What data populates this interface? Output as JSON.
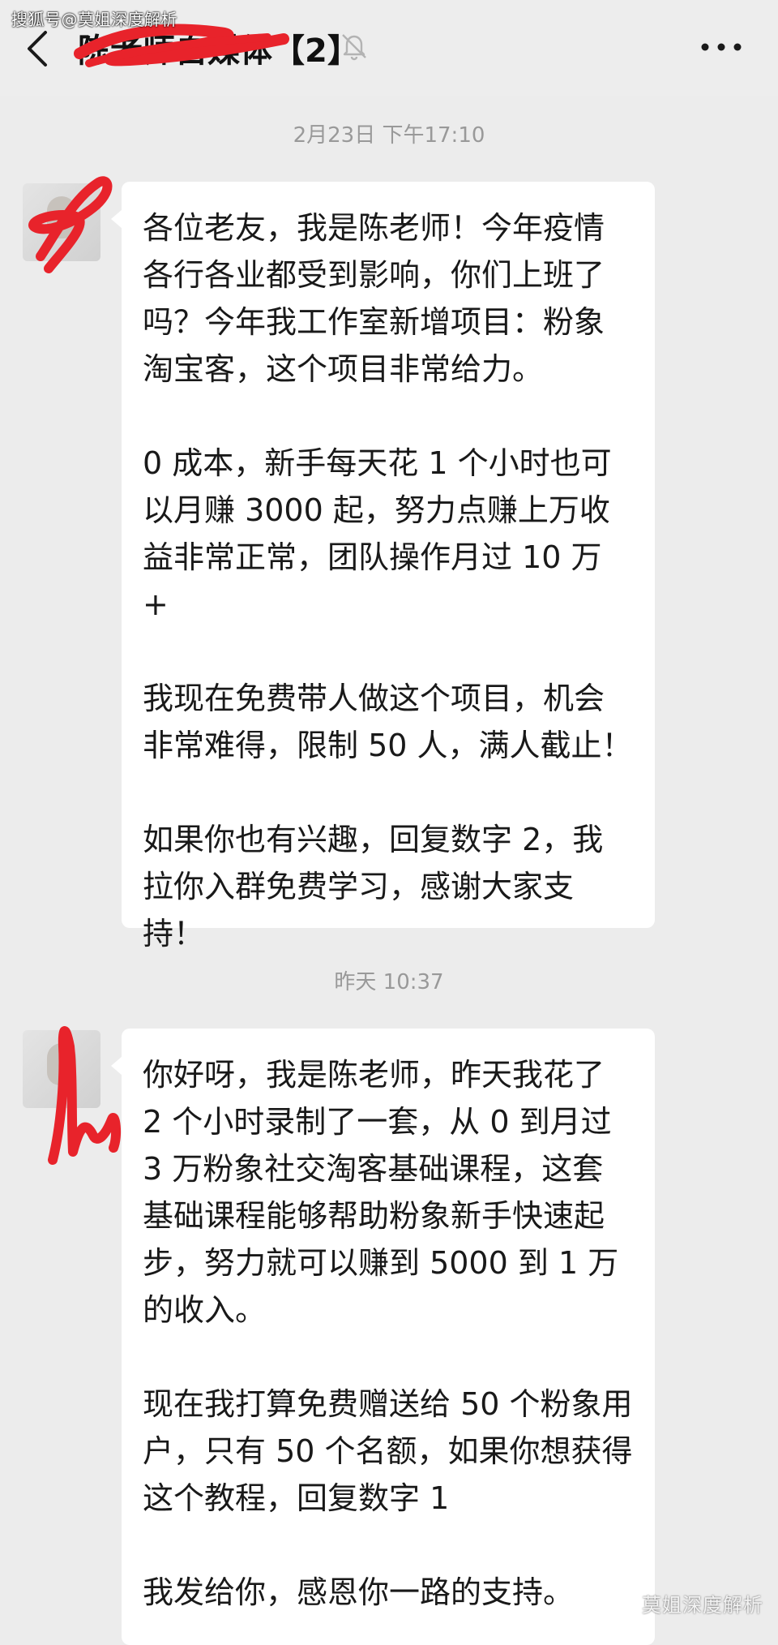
{
  "watermark_top": "搜狐号@莫姐深度解析",
  "header": {
    "title": "陈老师自媒体【2】",
    "back_icon": "chevron-left-icon",
    "mute_icon": "bell-off-icon",
    "more_icon": "ellipsis-icon"
  },
  "messages": [
    {
      "timestamp": "2月23日 下午17:10",
      "paragraphs": [
        "各位老友，我是陈老师！今年疫情各行各业都受到影响，你们上班了吗？今年我工作室新增项目：粉象淘宝客，这个项目非常给力。",
        "0 成本，新手每天花 1 个小时也可以月赚 3000 起，努力点赚上万收益非常正常，团队操作月过 10 万 +",
        "我现在免费带人做这个项目，机会非常难得，限制 50 人，满人截止！",
        "如果你也有兴趣，回复数字 2，我拉你入群免费学习，感谢大家支持！"
      ]
    },
    {
      "timestamp": "昨天 10:37",
      "paragraphs": [
        "你好呀，我是陈老师，昨天我花了 2 个小时录制了一套，从 0 到月过 3 万粉象社交淘客基础课程，这套基础课程能够帮助粉象新手快速起步，努力就可以赚到 5000 到 1 万的收入。",
        "现在我打算免费赠送给 50 个粉象用户，只有 50 个名额，如果你想获得这个教程，回复数字 1",
        "我发给你，感恩你一路的支持。"
      ]
    }
  ],
  "watermark_bottom": "莫姐深度解析",
  "colors": {
    "background": "#ececec",
    "bubble": "#ffffff",
    "redaction": "#e8232b",
    "timestamp": "#999999"
  }
}
